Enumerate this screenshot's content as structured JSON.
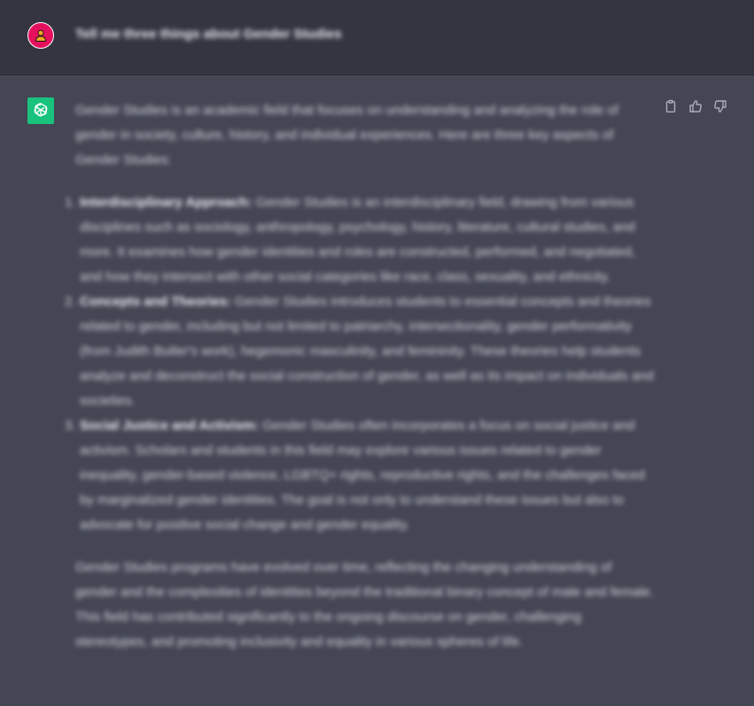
{
  "conversation": {
    "user": {
      "avatar_icon": "user-icon",
      "avatar_color": "#e5115e",
      "message": "Tell me three things about Gender Studies"
    },
    "assistant": {
      "avatar_icon": "openai-logo-icon",
      "avatar_color": "#19c37d",
      "actions": [
        {
          "name": "copy-icon"
        },
        {
          "name": "thumbs-up-icon"
        },
        {
          "name": "thumbs-down-icon"
        }
      ],
      "intro": "Gender Studies is an academic field that focuses on understanding and analyzing the role of gender in society, culture, history, and individual experiences. Here are three key aspects of Gender Studies:",
      "items": [
        {
          "number": "1.",
          "title": "Interdisciplinary Approach:",
          "text": " Gender Studies is an interdisciplinary field, drawing from various disciplines such as sociology, anthropology, psychology, history, literature, cultural studies, and more. It examines how gender identities and roles are constructed, performed, and negotiated, and how they intersect with other social categories like race, class, sexuality, and ethnicity."
        },
        {
          "number": "2.",
          "title": "Concepts and Theories:",
          "text": " Gender Studies introduces students to essential concepts and theories related to gender, including but not limited to patriarchy, intersectionality, gender performativity (from Judith Butler's work), hegemonic masculinity, and femininity. These theories help students analyze and deconstruct the social construction of gender, as well as its impact on individuals and societies."
        },
        {
          "number": "3.",
          "title": "Social Justice and Activism:",
          "text": " Gender Studies often incorporates a focus on social justice and activism. Scholars and students in this field may explore various issues related to gender inequality, gender-based violence, LGBTQ+ rights, reproductive rights, and the challenges faced by marginalized gender identities. The goal is not only to understand these issues but also to advocate for positive social change and gender equality."
        }
      ],
      "outro": "Gender Studies programs have evolved over time, reflecting the changing understanding of gender and the complexities of identities beyond the traditional binary concept of male and female. This field has contributed significantly to the ongoing discourse on gender, challenging stereotypes, and promoting inclusivity and equality in various spheres of life."
    }
  }
}
